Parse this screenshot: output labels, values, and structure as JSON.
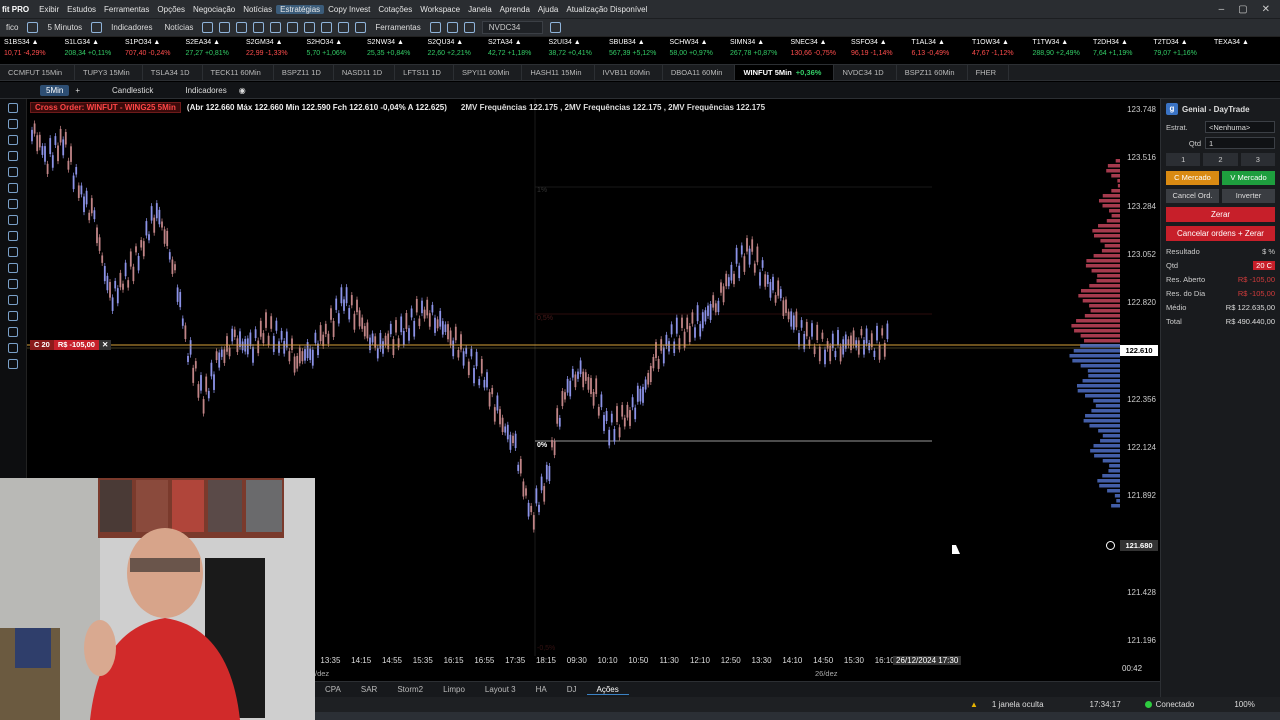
{
  "menubar": {
    "brand": "fit PRO",
    "items": [
      "Exibir",
      "Estudos",
      "Ferramentas",
      "Opções",
      "Negociação",
      "Notícias",
      "Estratégias",
      "Copy Invest",
      "Cotações",
      "Workspace",
      "Janela",
      "Aprenda",
      "Ajuda",
      "Atualização Disponível"
    ],
    "active_index": 6
  },
  "toolbar": {
    "left_label": "fico",
    "timeframe": "5 Minutos",
    "indicators": "Indicadores",
    "news": "Notícias",
    "tools": "Ferramentas",
    "symbol": "NVDC34"
  },
  "ticker": [
    {
      "sym": "S1BS34 ▲",
      "val": "10,71 -4,29%",
      "dir": "down"
    },
    {
      "sym": "S1LG34 ▲",
      "val": "208,34 +0,11%",
      "dir": "up"
    },
    {
      "sym": "S1PO34 ▲",
      "val": "707,40 -0,24%",
      "dir": "down"
    },
    {
      "sym": "S2EA34 ▲",
      "val": "27,27 +0,81%",
      "dir": "up"
    },
    {
      "sym": "S2GM34 ▲",
      "val": "22,99 -1,33%",
      "dir": "down"
    },
    {
      "sym": "S2HO34 ▲",
      "val": "5,70 +1,06%",
      "dir": "up"
    },
    {
      "sym": "S2NW34 ▲",
      "val": "25,35 +0,84%",
      "dir": "up"
    },
    {
      "sym": "S2QU34 ▲",
      "val": "22,60 +2,21%",
      "dir": "up"
    },
    {
      "sym": "S2TA34 ▲",
      "val": "42,72 +1,18%",
      "dir": "up"
    },
    {
      "sym": "S2UI34 ▲",
      "val": "38,72 +0,41%",
      "dir": "up"
    },
    {
      "sym": "SBUB34 ▲",
      "val": "567,39 +5,12%",
      "dir": "up"
    },
    {
      "sym": "SCHW34 ▲",
      "val": "58,00 +0,97%",
      "dir": "up"
    },
    {
      "sym": "SIMN34 ▲",
      "val": "267,78 +0,87%",
      "dir": "up"
    },
    {
      "sym": "SNEC34 ▲",
      "val": "130,66 -0,75%",
      "dir": "down"
    },
    {
      "sym": "SSFO34 ▲",
      "val": "96,19 -1,14%",
      "dir": "down"
    },
    {
      "sym": "T1AL34 ▲",
      "val": "6,13 -0,49%",
      "dir": "down"
    },
    {
      "sym": "T1OW34 ▲",
      "val": "47,67 -1,12%",
      "dir": "down"
    },
    {
      "sym": "T1TW34 ▲",
      "val": "288,90 +2,49%",
      "dir": "up"
    },
    {
      "sym": "T2DH34 ▲",
      "val": "7,64 +1,19%",
      "dir": "up"
    },
    {
      "sym": "T2TD34 ▲",
      "val": "79,07 +1,16%",
      "dir": "up"
    },
    {
      "sym": "TEXA34 ▲",
      "val": "",
      "dir": "up"
    }
  ],
  "chart_tabs": [
    {
      "label": "CCMFUT 15Min"
    },
    {
      "label": "TUPY3 15Min"
    },
    {
      "label": "TSLA34 1D"
    },
    {
      "label": "TECK11 60Min"
    },
    {
      "label": "BSPZ11 1D"
    },
    {
      "label": "NASD11 1D"
    },
    {
      "label": "LFTS11 1D"
    },
    {
      "label": "SPYI11 60Min"
    },
    {
      "label": "HASH11 15Min"
    },
    {
      "label": "IVVB11 60Min"
    },
    {
      "label": "DBOA11 60Min"
    },
    {
      "label": "WINFUT 5Min",
      "chg": "+0,36%",
      "active": true
    },
    {
      "label": "NVDC34 1D"
    },
    {
      "label": "BSPZ11 60Min"
    },
    {
      "label": "FHER"
    }
  ],
  "chartbar": {
    "timeframe": "5Min",
    "type": "Candlestick",
    "indicators": "Indicadores"
  },
  "info": {
    "cross_order": "Cross Order: WINFUT - WING25 5Min",
    "ohlc": "(Abr 122.660 Máx 122.660 Mín 122.590 Fch 122.610 -0,04% A 122.625)",
    "mv": "2MV Frequências 122.175 , 2MV Frequências 122.175 , 2MV Frequências 122.175"
  },
  "position_label": {
    "qty": "C 20",
    "pnl": "R$ -105,00"
  },
  "fib_labels": {
    "l100": "1%",
    "l50": "0,5%",
    "l0": "0%",
    "lneg": "-0,5%"
  },
  "y_labels": [
    "123.748",
    "123.516",
    "123.284",
    "123.052",
    "122.820",
    "122.588",
    "122.356",
    "122.124",
    "121.892",
    "121.660",
    "121.428",
    "121.196"
  ],
  "price_flag": "122.610",
  "cursor_flag": "121.680",
  "x_labels": [
    "13:35",
    "14:15",
    "14:55",
    "15:35",
    "16:15",
    "16:55",
    "17:35",
    "18:15",
    "09:30",
    "10:10",
    "10:50",
    "11:30",
    "12:10",
    "12:50",
    "13:30",
    "14:10",
    "14:50",
    "15:30",
    "16:10"
  ],
  "x_cursor": "26/12/2024 17:30",
  "date_left": "/dez",
  "date_mid": "26/dez",
  "clock_small": "00:42",
  "layouts": {
    "items": [
      "CPA",
      "SAR",
      "Storm2",
      "Limpo",
      "Layout 3",
      "HA",
      "DJ",
      "Ações"
    ],
    "active_index": 7
  },
  "status": {
    "hidden": "1 janela oculta",
    "time": "17:34:17",
    "conn": "Conectado",
    "zoom": "100%"
  },
  "panel": {
    "title": "Genial - DayTrade",
    "estrat_label": "Estrat.",
    "estrat_value": "<Nenhuma>",
    "qtd_label": "Qtd",
    "qtd_value": "1",
    "quick": [
      "1",
      "2",
      "3"
    ],
    "buy_market": "C Mercado",
    "sell_market": "V Mercado",
    "cancel_orders": "Cancel Ord.",
    "invert": "Inverter",
    "zero": "Zerar",
    "cancel_zero": "Cancelar ordens + Zerar",
    "result_label": "Resultado",
    "rows": [
      {
        "k": "Qtd",
        "v": "20 C",
        "style": "badge"
      },
      {
        "k": "Res. Aberto",
        "v": "R$ -105,00",
        "style": "neg"
      },
      {
        "k": "Res. do Dia",
        "v": "R$ -105,00",
        "style": "neg"
      },
      {
        "k": "Médio",
        "v": "R$ 122.635,00",
        "style": "pos"
      },
      {
        "k": "Total",
        "v": "R$ 490.440,00",
        "style": "pos"
      }
    ]
  },
  "colors": {
    "up": "#33cc66",
    "down": "#ff4d4d",
    "accent": "#3b82c4",
    "order_line": "#d8a23a"
  }
}
